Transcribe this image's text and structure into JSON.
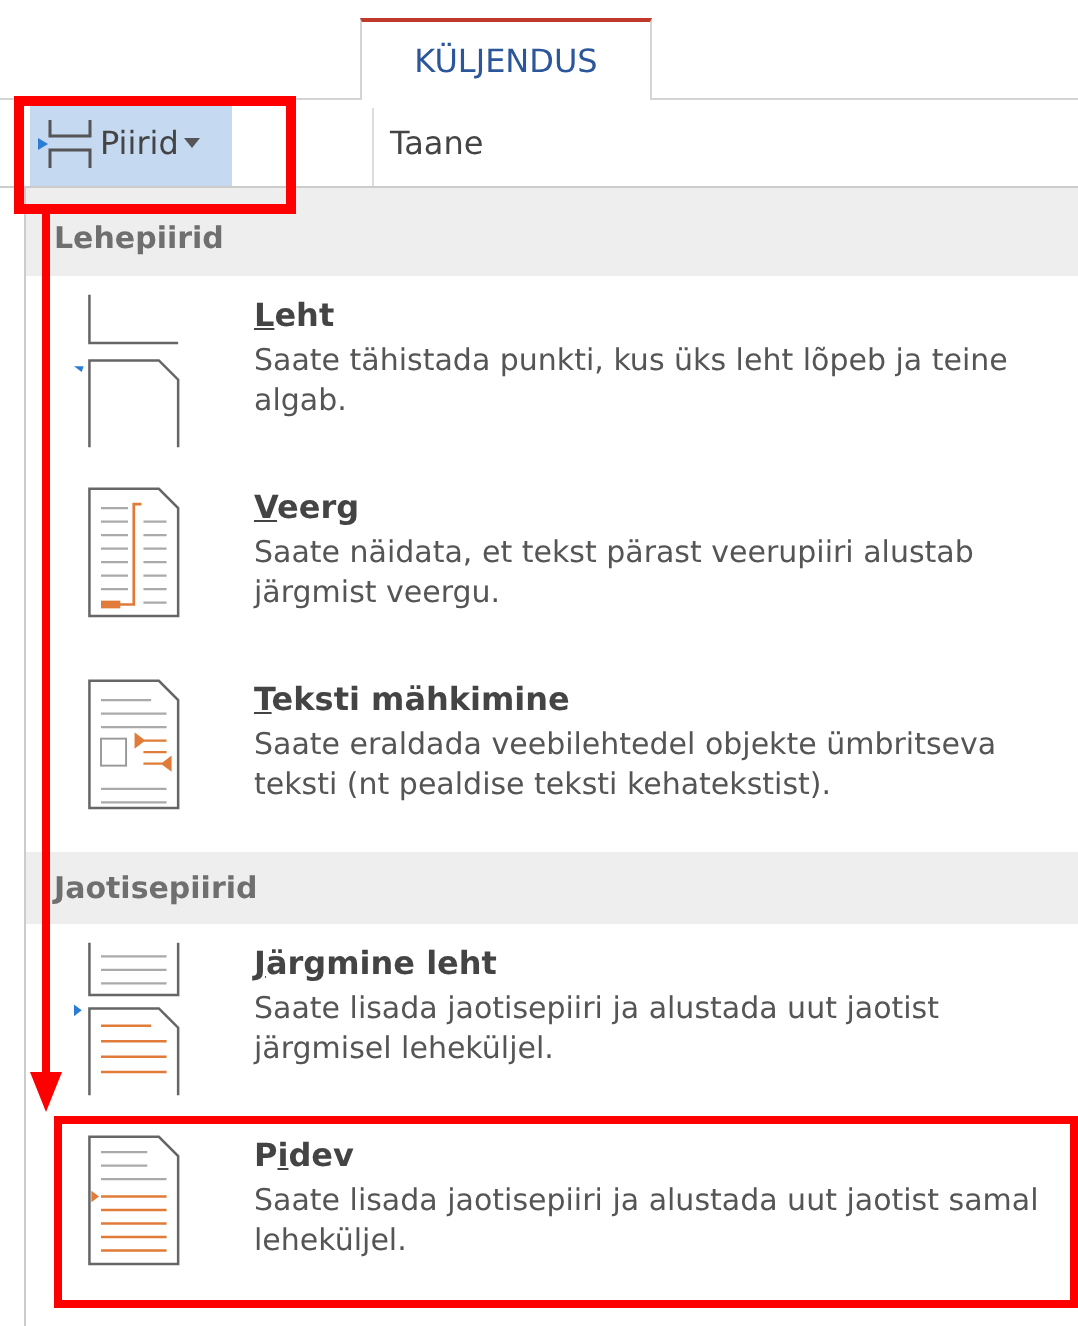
{
  "tabs": [
    {
      "label": "KÜLJENDUS",
      "selected": true
    }
  ],
  "ribbon": {
    "breaks_button": {
      "label": "Piirid",
      "pressed": true,
      "highlighted": true
    },
    "indent_label": "Taane"
  },
  "callout_arrow": true,
  "menu": {
    "sections": [
      {
        "header": "Lehepiirid",
        "items": [
          {
            "kind": "page",
            "title": {
              "key": "L",
              "after": "eht"
            },
            "description": "Saate tähistada punkti, kus üks leht lõpeb ja teine algab.",
            "highlighted": false
          },
          {
            "kind": "column",
            "title": {
              "key": "V",
              "after": "eerg"
            },
            "description": "Saate näidata, et tekst pärast veerupiiri alustab järgmist veergu.",
            "highlighted": false
          },
          {
            "kind": "wrap",
            "title": {
              "key": "T",
              "after": "eksti mähkimine"
            },
            "description": "Saate eraldada veebilehtedel objekte ümbritseva teksti (nt pealdise teksti kehatekstist).",
            "highlighted": false
          }
        ]
      },
      {
        "header": "Jaotisepiirid",
        "items": [
          {
            "kind": "next",
            "title": {
              "key": "J",
              "after": "ärgmine leht"
            },
            "description": "Saate lisada jaotisepiiri ja alustada uut jaotist järgmisel leheküljel.",
            "highlighted": false
          },
          {
            "kind": "continuous",
            "title": {
              "before": "P",
              "key": "i",
              "after": "dev"
            },
            "description": "Saate lisada jaotisepiiri ja alustada uut jaotist samal leheküljel.",
            "highlighted": true
          }
        ]
      }
    ]
  }
}
